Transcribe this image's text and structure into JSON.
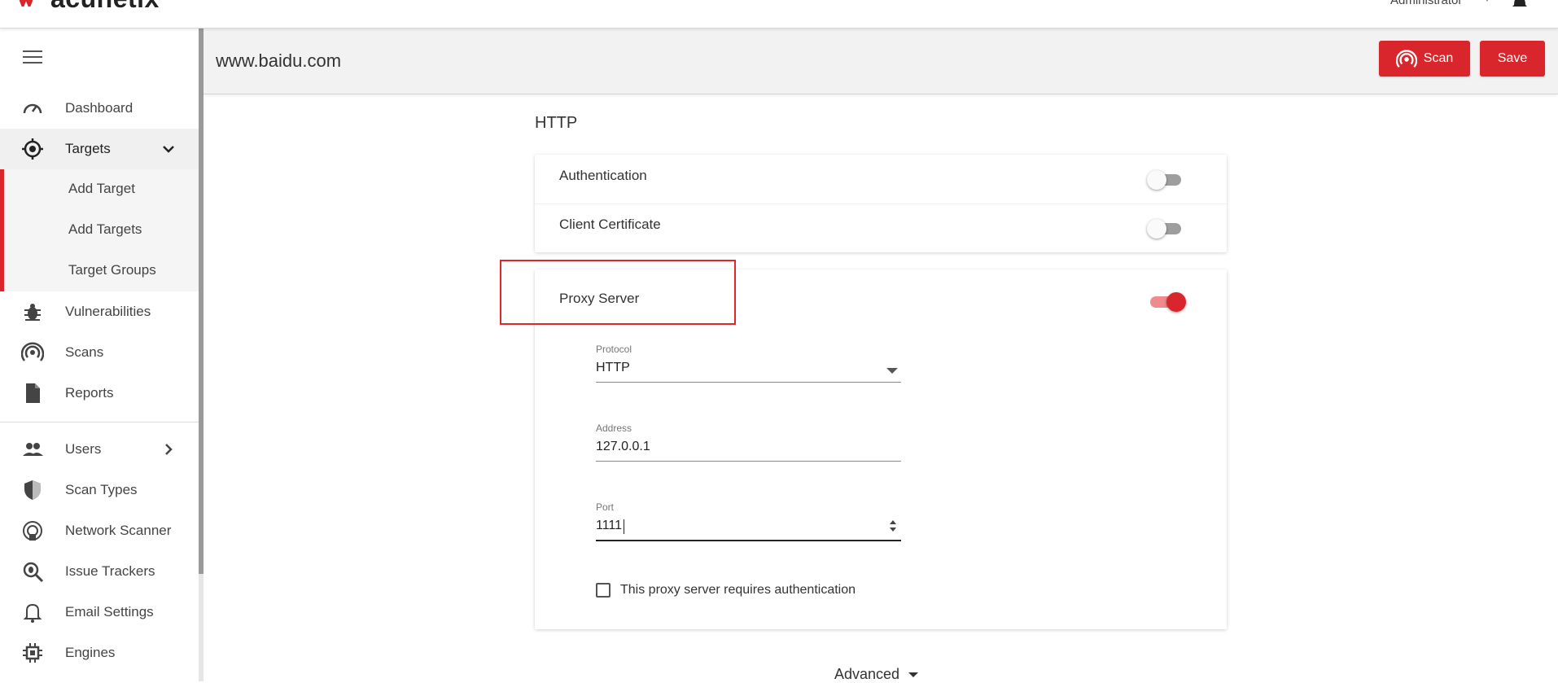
{
  "app": {
    "logo_text": "acunetix",
    "user": "Administrator"
  },
  "sidebar": {
    "items": [
      {
        "label": "Dashboard",
        "icon": "dashboard-icon"
      },
      {
        "label": "Targets",
        "icon": "target-icon"
      },
      {
        "label": "Vulnerabilities",
        "icon": "bug-icon"
      },
      {
        "label": "Scans",
        "icon": "scan-icon"
      },
      {
        "label": "Reports",
        "icon": "report-icon"
      },
      {
        "label": "Users",
        "icon": "users-icon"
      },
      {
        "label": "Scan Types",
        "icon": "shield-icon"
      },
      {
        "label": "Network Scanner",
        "icon": "network-scanner-icon"
      },
      {
        "label": "Issue Trackers",
        "icon": "issue-tracker-icon"
      },
      {
        "label": "Email Settings",
        "icon": "bell-icon"
      },
      {
        "label": "Engines",
        "icon": "engine-icon"
      }
    ],
    "target_subitems": [
      "Add Target",
      "Add Targets",
      "Target Groups"
    ]
  },
  "header": {
    "title": "www.baidu.com",
    "scan_label": "Scan",
    "save_label": "Save"
  },
  "main": {
    "section_title": "HTTP",
    "authentication_label": "Authentication",
    "authentication_enabled": false,
    "client_certificate_label": "Client Certificate",
    "client_certificate_enabled": false,
    "proxy_label": "Proxy Server",
    "proxy_enabled": true,
    "protocol_label": "Protocol",
    "protocol_value": "HTTP",
    "address_label": "Address",
    "address_value": "127.0.0.1",
    "port_label": "Port",
    "port_value": "1111",
    "proxy_auth_label": "This proxy server requires authentication",
    "proxy_auth_checked": false,
    "advanced_label": "Advanced"
  },
  "colors": {
    "accent": "#d9262c",
    "toggle_off": "#9e9e9e"
  }
}
